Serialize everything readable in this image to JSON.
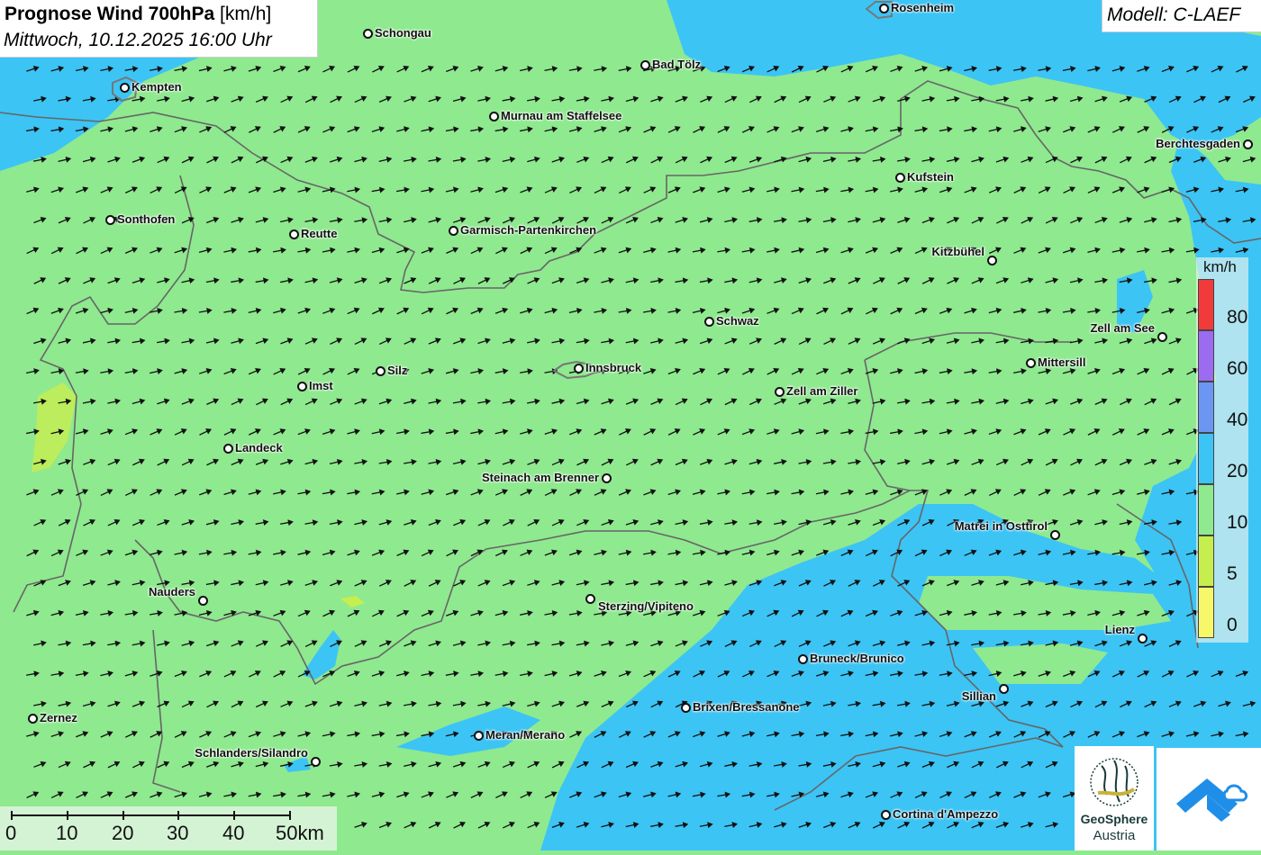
{
  "title": {
    "main_bold": "Prognose Wind 700hPa",
    "main_unit": " [km/h]",
    "subtitle": "Mittwoch, 10.12.2025 16:00 Uhr"
  },
  "model_label": "Modell: C-LAEF",
  "cities": [
    {
      "id": "rosenheim",
      "name": "Rosenheim"
    },
    {
      "id": "schongau",
      "name": "Schongau"
    },
    {
      "id": "bad-toelz",
      "name": "Bad Tölz"
    },
    {
      "id": "kempten",
      "name": "Kempten"
    },
    {
      "id": "murnau",
      "name": "Murnau am Staffelsee"
    },
    {
      "id": "berchtesgaden",
      "name": "Berchtesgaden"
    },
    {
      "id": "kufstein",
      "name": "Kufstein"
    },
    {
      "id": "sonthofen",
      "name": "Sonthofen"
    },
    {
      "id": "reutte",
      "name": "Reutte"
    },
    {
      "id": "garmisch",
      "name": "Garmisch-Partenkirchen"
    },
    {
      "id": "kitzbuehel",
      "name": "Kitzbühel"
    },
    {
      "id": "schwaz",
      "name": "Schwaz"
    },
    {
      "id": "zell-am-see",
      "name": "Zell am See"
    },
    {
      "id": "mittersill",
      "name": "Mittersill"
    },
    {
      "id": "silz",
      "name": "Silz"
    },
    {
      "id": "innsbruck",
      "name": "Innsbruck"
    },
    {
      "id": "imst",
      "name": "Imst"
    },
    {
      "id": "zell-am-ziller",
      "name": "Zell am Ziller"
    },
    {
      "id": "landeck",
      "name": "Landeck"
    },
    {
      "id": "steinach",
      "name": "Steinach am Brenner"
    },
    {
      "id": "matrei",
      "name": "Matrei in Osttirol"
    },
    {
      "id": "nauders",
      "name": "Nauders"
    },
    {
      "id": "sterzing",
      "name": "Sterzing/Vipiteno"
    },
    {
      "id": "lienz",
      "name": "Lienz"
    },
    {
      "id": "bruneck",
      "name": "Bruneck/Brunico"
    },
    {
      "id": "sillian",
      "name": "Sillian"
    },
    {
      "id": "brixen",
      "name": "Brixen/Bressanone"
    },
    {
      "id": "zernez",
      "name": "Zernez"
    },
    {
      "id": "meran",
      "name": "Meran/Merano"
    },
    {
      "id": "schlanders",
      "name": "Schlanders/Silandro"
    },
    {
      "id": "cortina",
      "name": "Cortina d'Ampezzo"
    }
  ],
  "legend": {
    "unit": "km/h",
    "classes": [
      {
        "label": "80",
        "color": "#f23a3a"
      },
      {
        "label": "60",
        "color": "#9b6bf0"
      },
      {
        "label": "40",
        "color": "#6b97f2"
      },
      {
        "label": "20",
        "color": "#3cc4f5"
      },
      {
        "label": "10",
        "color": "#8fe98f"
      },
      {
        "label": "5",
        "color": "#c6ee4f"
      },
      {
        "label": "0",
        "color": "#f7f76a"
      }
    ]
  },
  "scale": {
    "labels": [
      "0",
      "10",
      "20",
      "30",
      "40",
      "50km"
    ]
  },
  "colors": {
    "land_green": "#8fe98f",
    "wind_blue": "#3cc4f5",
    "yellow_green": "#c6ee4f",
    "border": "#666666"
  },
  "logos": {
    "geosphere_line1": "GeoSphere",
    "geosphere_line2": "Austria",
    "geosphere_icon": "geosphere-logo-icon",
    "second_icon": "cloud-arrow-logo-icon"
  }
}
